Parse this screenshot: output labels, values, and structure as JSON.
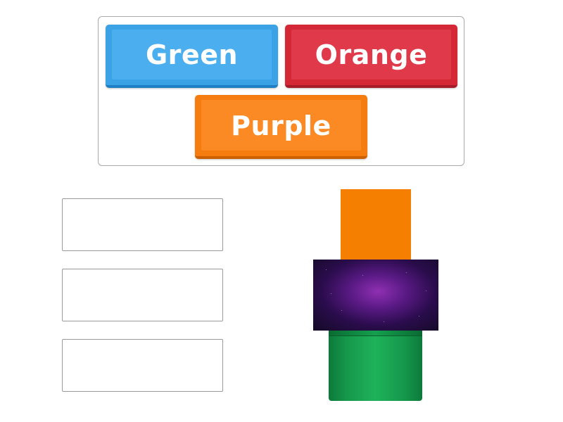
{
  "word_bank": {
    "items": [
      {
        "label": "Green",
        "color": "#3ba2e6"
      },
      {
        "label": "Orange",
        "color": "#d52837"
      },
      {
        "label": "Purple",
        "color": "#f57c0f"
      }
    ]
  },
  "drop_targets": {
    "boxes": [
      {
        "value": ""
      },
      {
        "value": ""
      },
      {
        "value": ""
      }
    ]
  },
  "images": {
    "items": [
      {
        "icon": "orange-color-swatch",
        "color": "#f57f00"
      },
      {
        "icon": "purple-galaxy-swatch",
        "color": "#6a1f97"
      },
      {
        "icon": "green-pipe-swatch",
        "color": "#1a9f4f"
      }
    ]
  }
}
